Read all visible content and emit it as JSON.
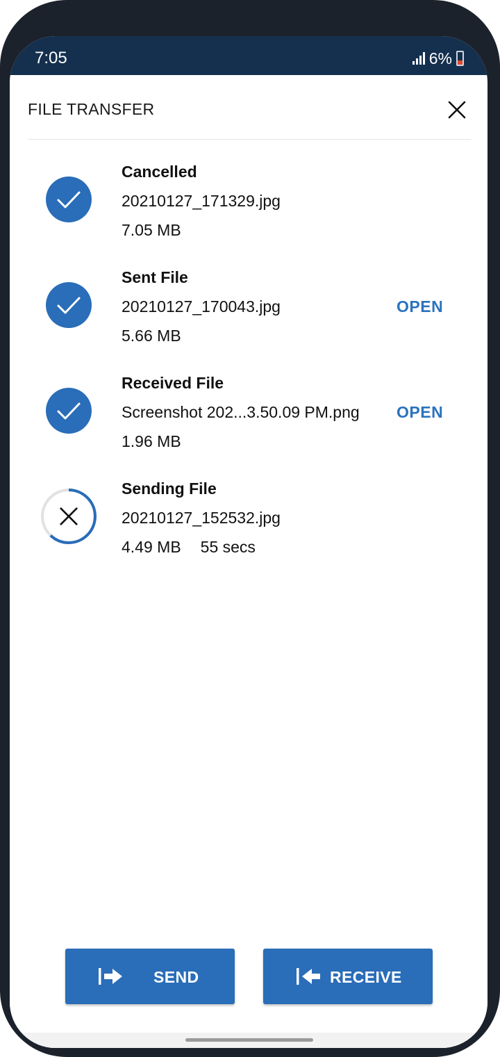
{
  "status_bar": {
    "time": "7:05",
    "battery": "6%",
    "colors": {
      "background": "#15304e",
      "battery_low": "#e2472f"
    }
  },
  "header": {
    "title": "FILE TRANSFER",
    "close_icon": "close-icon"
  },
  "transfers": [
    {
      "status": "Cancelled",
      "file_name": "20210127_171329.jpg",
      "size": "7.05 MB",
      "action": "",
      "time_remaining": "",
      "icon": "check-circle-icon"
    },
    {
      "status": "Sent File",
      "file_name": "20210127_170043.jpg",
      "size": "5.66 MB",
      "action": "OPEN",
      "time_remaining": "",
      "icon": "check-circle-icon"
    },
    {
      "status": "Received File",
      "file_name": "Screenshot 202...3.50.09 PM.png",
      "size": "1.96 MB",
      "action": "OPEN",
      "time_remaining": "",
      "icon": "check-circle-icon"
    },
    {
      "status": "Sending File",
      "file_name": "20210127_152532.jpg",
      "size": "4.49 MB",
      "action": "",
      "time_remaining": "55 secs",
      "icon": "cancel-progress-icon",
      "progress": 0.62
    }
  ],
  "buttons": {
    "send_label": "SEND",
    "receive_label": "RECEIVE",
    "send_icon": "send-arrow-icon",
    "receive_icon": "receive-arrow-icon"
  },
  "colors": {
    "accent": "#2a6db8",
    "link": "#2a73bd",
    "frame": "#1c222b"
  }
}
